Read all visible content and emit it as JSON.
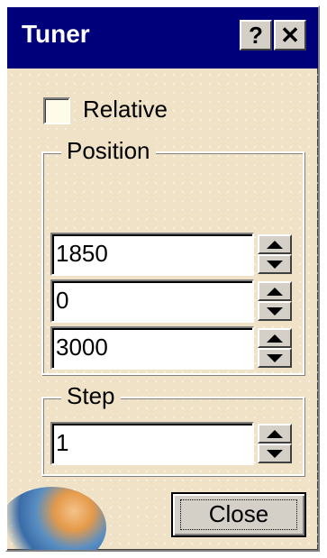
{
  "window": {
    "title": "Tuner",
    "help_button": "?",
    "close_button": "✕"
  },
  "relative": {
    "label": "Relative",
    "checked": false
  },
  "position": {
    "legend": "Position",
    "fields": [
      "1850",
      "0",
      "3000"
    ]
  },
  "step": {
    "legend": "Step",
    "value": "1"
  },
  "buttons": {
    "close_label": "Close"
  },
  "colors": {
    "titlebar": "#00007b",
    "dialog_background": "#efe2c6",
    "button_face": "#d4d0c8"
  }
}
